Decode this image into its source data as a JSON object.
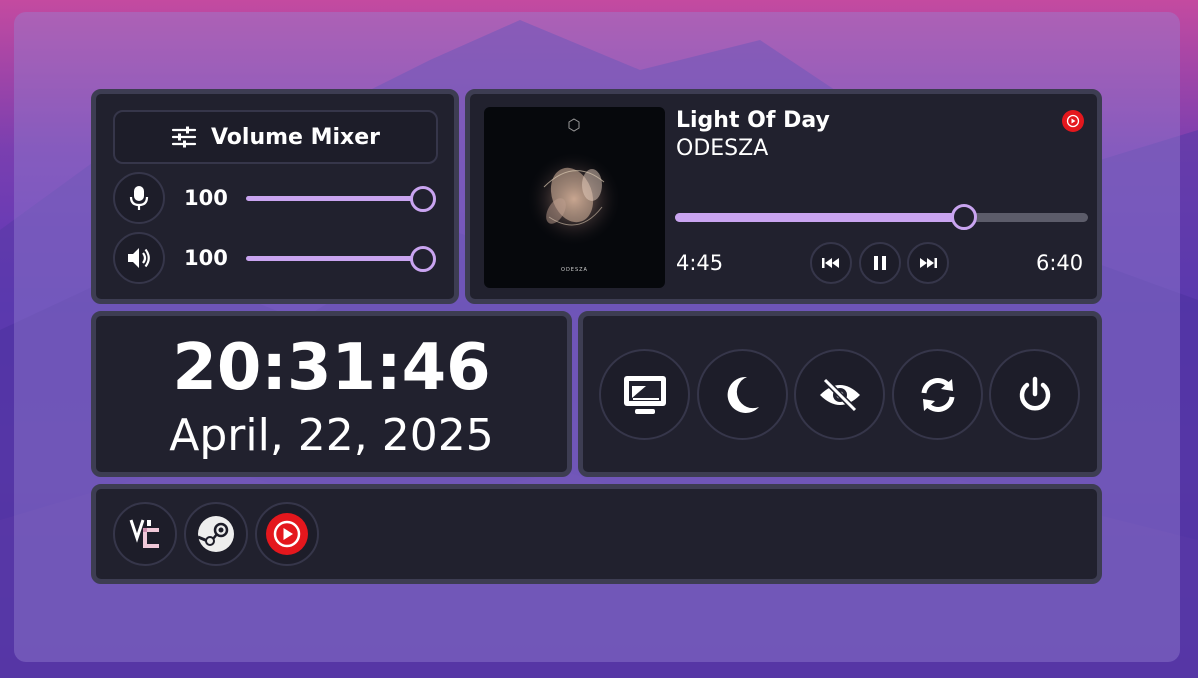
{
  "volume_mixer": {
    "title": "Volume Mixer",
    "microphone": {
      "level_label": "100",
      "level": 100,
      "icon": "microphone-icon"
    },
    "speaker": {
      "level_label": "100",
      "level": 100,
      "icon": "speaker-icon"
    }
  },
  "media": {
    "track_title": "Light Of Day",
    "artist": "ODESZA",
    "album_art_text": "ODESZA",
    "elapsed": "4:45",
    "duration": "6:40",
    "progress": 0.7125,
    "source_icon": "youtube-music-icon"
  },
  "clock": {
    "time": "20:31:46",
    "date": "April, 22, 2025"
  },
  "power_actions": [
    {
      "name": "screen-lock-button",
      "icon": "monitor-icon"
    },
    {
      "name": "sleep-button",
      "icon": "moon-icon"
    },
    {
      "name": "hide-button",
      "icon": "eye-off-icon"
    },
    {
      "name": "reboot-button",
      "icon": "refresh-icon"
    },
    {
      "name": "shutdown-button",
      "icon": "power-icon"
    }
  ],
  "launcher_apps": [
    {
      "name": "vencord",
      "icon": "vencord-icon"
    },
    {
      "name": "steam",
      "icon": "steam-icon"
    },
    {
      "name": "youtube-music",
      "icon": "youtube-music-icon"
    }
  ],
  "colors": {
    "accent": "#c9a4f0",
    "card_bg": "#21212e",
    "card_border": "#3d3d52",
    "youtube_red": "#e4171d"
  }
}
